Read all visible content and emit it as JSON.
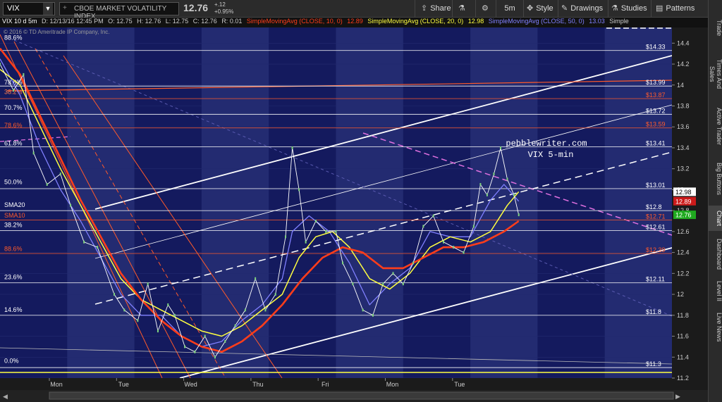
{
  "toolbar": {
    "symbol": "VIX",
    "name": "CBOE MARKET VOLATILITY INDEX",
    "last": "12.76",
    "change": "+.12",
    "change_pct": "+0.95%",
    "share": "Share",
    "timeframe": "5m",
    "style": "Style",
    "drawings": "Drawings",
    "studies": "Studies",
    "patterns": "Patterns"
  },
  "infobar": {
    "period": "VIX 10 d 5m",
    "date": "D: 12/13/16 12:45 PM",
    "open": "O: 12.75",
    "high": "H: 12.76",
    "low": "L: 12.75",
    "close": "C: 12.76",
    "range": "R: 0.01",
    "sma10_label": "SimpleMovingAvg (CLOSE, 10, 0)",
    "sma10_value": "12.89",
    "sma20_label": "SimpleMovingAvg (CLOSE, 20, 0)",
    "sma20_value": "12.98",
    "sma50_label": "SimpleMovingAvg (CLOSE, 50, 0)",
    "sma50_value": "13.03",
    "more": "Simple"
  },
  "sidebar": [
    "Trade",
    "Times And Sales",
    "Active Trader",
    "Big Buttons",
    "Chart",
    "Dashboard",
    "Level II",
    "Live News"
  ],
  "chart_data": {
    "type": "line",
    "title": "",
    "copyright": "© 2016 © TD Ameritrade IP Company, Inc.",
    "watermark": [
      "pebblewriter.com",
      "VIX 5-min"
    ],
    "x_ticks": [
      "Mon",
      "Tue",
      "Wed",
      "Thu",
      "Fri",
      "Mon",
      "Tue"
    ],
    "y_ticks": [
      11.2,
      11.4,
      11.6,
      11.8,
      12,
      12.2,
      12.4,
      12.6,
      12.8,
      13,
      13.2,
      13.4,
      13.6,
      13.8,
      14,
      14.2,
      14.4
    ],
    "ylim": [
      11.2,
      14.55
    ],
    "grid": true,
    "x_range": [
      0,
      10
    ],
    "close": [
      [
        0,
        14.2
      ],
      [
        0.2,
        13.95
      ],
      [
        0.35,
        14.1
      ],
      [
        0.5,
        13.35
      ],
      [
        0.7,
        13.05
      ],
      [
        0.9,
        13.15
      ],
      [
        1.05,
        12.85
      ],
      [
        1.25,
        12.5
      ],
      [
        1.45,
        12.45
      ],
      [
        1.7,
        12.0
      ],
      [
        1.85,
        11.85
      ],
      [
        2.05,
        11.75
      ],
      [
        2.2,
        12.1
      ],
      [
        2.35,
        11.65
      ],
      [
        2.5,
        11.9
      ],
      [
        2.6,
        11.8
      ],
      [
        2.75,
        11.5
      ],
      [
        2.9,
        11.45
      ],
      [
        3.05,
        11.6
      ],
      [
        3.2,
        11.4
      ],
      [
        3.35,
        11.55
      ],
      [
        3.5,
        11.7
      ],
      [
        3.65,
        11.85
      ],
      [
        3.8,
        12.15
      ],
      [
        3.95,
        11.85
      ],
      [
        4.1,
        12.0
      ],
      [
        4.25,
        12.55
      ],
      [
        4.35,
        13.4
      ],
      [
        4.45,
        13.0
      ],
      [
        4.55,
        12.5
      ],
      [
        4.7,
        12.7
      ],
      [
        4.85,
        12.6
      ],
      [
        5.0,
        12.6
      ],
      [
        5.1,
        12.3
      ],
      [
        5.25,
        12.1
      ],
      [
        5.4,
        11.85
      ],
      [
        5.55,
        11.8
      ],
      [
        5.7,
        12.1
      ],
      [
        5.85,
        12.2
      ],
      [
        6.0,
        12.1
      ],
      [
        6.15,
        12.3
      ],
      [
        6.3,
        12.65
      ],
      [
        6.45,
        12.75
      ],
      [
        6.6,
        12.5
      ],
      [
        6.75,
        12.45
      ],
      [
        6.9,
        12.4
      ],
      [
        7.05,
        12.65
      ],
      [
        7.15,
        13.05
      ],
      [
        7.25,
        12.95
      ],
      [
        7.35,
        13.15
      ],
      [
        7.45,
        13.4
      ],
      [
        7.55,
        13.1
      ],
      [
        7.65,
        12.95
      ],
      [
        7.72,
        12.76
      ]
    ],
    "series": [
      {
        "name": "SimpleMovingAvg (CLOSE, 10, 0)",
        "color": "#8080ff",
        "last": 12.89,
        "points": [
          [
            0,
            14.25
          ],
          [
            0.3,
            13.9
          ],
          [
            0.6,
            13.4
          ],
          [
            0.9,
            13.0
          ],
          [
            1.2,
            12.7
          ],
          [
            1.5,
            12.35
          ],
          [
            1.8,
            12.0
          ],
          [
            2.1,
            11.8
          ],
          [
            2.4,
            11.8
          ],
          [
            2.7,
            11.6
          ],
          [
            3.0,
            11.5
          ],
          [
            3.3,
            11.55
          ],
          [
            3.6,
            11.75
          ],
          [
            3.9,
            11.9
          ],
          [
            4.2,
            12.15
          ],
          [
            4.35,
            12.6
          ],
          [
            4.6,
            12.75
          ],
          [
            4.9,
            12.6
          ],
          [
            5.2,
            12.3
          ],
          [
            5.5,
            11.9
          ],
          [
            5.8,
            12.1
          ],
          [
            6.1,
            12.25
          ],
          [
            6.4,
            12.6
          ],
          [
            6.7,
            12.55
          ],
          [
            7.0,
            12.55
          ],
          [
            7.3,
            12.9
          ],
          [
            7.5,
            13.05
          ],
          [
            7.72,
            12.89
          ]
        ]
      },
      {
        "name": "SimpleMovingAvg (CLOSE, 20, 0)",
        "color": "#ffff40",
        "last": 12.98,
        "points": [
          [
            0,
            14.15
          ],
          [
            0.3,
            14.0
          ],
          [
            0.6,
            13.6
          ],
          [
            0.9,
            13.2
          ],
          [
            1.2,
            12.85
          ],
          [
            1.5,
            12.5
          ],
          [
            1.8,
            12.15
          ],
          [
            2.1,
            11.95
          ],
          [
            2.4,
            11.85
          ],
          [
            2.7,
            11.75
          ],
          [
            3.0,
            11.65
          ],
          [
            3.3,
            11.6
          ],
          [
            3.6,
            11.7
          ],
          [
            3.9,
            11.85
          ],
          [
            4.2,
            12.0
          ],
          [
            4.45,
            12.35
          ],
          [
            4.7,
            12.55
          ],
          [
            4.95,
            12.6
          ],
          [
            5.2,
            12.45
          ],
          [
            5.5,
            12.15
          ],
          [
            5.8,
            12.05
          ],
          [
            6.1,
            12.2
          ],
          [
            6.4,
            12.45
          ],
          [
            6.7,
            12.55
          ],
          [
            7.0,
            12.5
          ],
          [
            7.3,
            12.6
          ],
          [
            7.55,
            12.85
          ],
          [
            7.72,
            12.98
          ]
        ]
      },
      {
        "name": "SimpleMovingAvg (CLOSE, 50, 0)",
        "color": "#ff3d1a",
        "last": 13.03,
        "points": [
          [
            0,
            14.35
          ],
          [
            0.3,
            14.1
          ],
          [
            0.6,
            13.7
          ],
          [
            0.9,
            13.3
          ],
          [
            1.2,
            12.9
          ],
          [
            1.5,
            12.55
          ],
          [
            1.8,
            12.2
          ],
          [
            2.1,
            11.95
          ],
          [
            2.4,
            11.75
          ],
          [
            2.7,
            11.6
          ],
          [
            3.0,
            11.5
          ],
          [
            3.3,
            11.45
          ],
          [
            3.6,
            11.55
          ],
          [
            3.9,
            11.7
          ],
          [
            4.2,
            11.9
          ],
          [
            4.5,
            12.15
          ],
          [
            4.8,
            12.35
          ],
          [
            5.1,
            12.45
          ],
          [
            5.4,
            12.4
          ],
          [
            5.7,
            12.25
          ],
          [
            6.0,
            12.25
          ],
          [
            6.3,
            12.35
          ],
          [
            6.6,
            12.45
          ],
          [
            6.9,
            12.45
          ],
          [
            7.2,
            12.5
          ],
          [
            7.5,
            12.6
          ],
          [
            7.72,
            12.7
          ]
        ]
      }
    ],
    "horizontal_levels": [
      {
        "value": 14.33,
        "label": "$14.33",
        "color": "#ffffff"
      },
      {
        "value": 13.99,
        "label": "$13.99",
        "color": "#ffffff"
      },
      {
        "value": 13.87,
        "label": "$13.87",
        "color": "#ff5a2a"
      },
      {
        "value": 13.72,
        "label": "$13.72",
        "color": "#ffffff"
      },
      {
        "value": 13.59,
        "label": "$13.59",
        "color": "#ff5a2a"
      },
      {
        "value": 13.41,
        "label": "$13.41",
        "color": "#ffffff"
      },
      {
        "value": 13.01,
        "label": "$13.01",
        "color": "#ffffff"
      },
      {
        "value": 12.8,
        "label": "$12.8",
        "color": "#ffffff"
      },
      {
        "value": 12.71,
        "label": "$12.71",
        "color": "#ff5a2a"
      },
      {
        "value": 12.61,
        "label": "$12.61",
        "color": "#ffffff"
      },
      {
        "value": 12.39,
        "label": "$12.39",
        "color": "#ff5a2a"
      },
      {
        "value": 12.11,
        "label": "$12.11",
        "color": "#ffffff"
      },
      {
        "value": 11.8,
        "label": "$11.8",
        "color": "#ffffff"
      },
      {
        "value": 11.3,
        "label": "$11.3",
        "color": "#ffffff"
      }
    ],
    "fib_labels": [
      {
        "value": 14.42,
        "text": "88.6%",
        "color": "#ffffff"
      },
      {
        "value": 13.99,
        "text": "78.6%",
        "color": "#ffffff"
      },
      {
        "value": 13.9,
        "text": "38.2%",
        "color": "#ff7f50"
      },
      {
        "value": 13.75,
        "text": "70.7%",
        "color": "#ffffff"
      },
      {
        "value": 13.58,
        "text": "78.6%",
        "color": "#ff5a2a"
      },
      {
        "value": 13.41,
        "text": "61.8%",
        "color": "#ffffff"
      },
      {
        "value": 13.04,
        "text": "50.0%",
        "color": "#ffffff"
      },
      {
        "value": 12.82,
        "text": "SMA20",
        "color": "#ffffff"
      },
      {
        "value": 12.72,
        "text": "SMA10",
        "color": "#ff5a2a"
      },
      {
        "value": 12.63,
        "text": "38.2%",
        "color": "#ffffff"
      },
      {
        "value": 12.4,
        "text": "88.6%",
        "color": "#ff5a2a"
      },
      {
        "value": 12.13,
        "text": "23.6%",
        "color": "#ffffff"
      },
      {
        "value": 11.82,
        "text": "14.6%",
        "color": "#ffffff"
      },
      {
        "value": 11.33,
        "text": "0.0%",
        "color": "#ffffff"
      }
    ],
    "price_tags": [
      {
        "value": 12.98,
        "text": "12.98",
        "bg": "#ffffff",
        "fg": "#000000"
      },
      {
        "value": 12.89,
        "text": "12.89",
        "bg": "#cc1a1a",
        "fg": "#ffffff"
      },
      {
        "value": 12.76,
        "text": "12.76",
        "bg": "#1faa1f",
        "fg": "#ffffff"
      }
    ],
    "colors": {
      "background": "#141a5e",
      "band": "#303a82",
      "candle_line": "#ffffff",
      "axis_bg": "#1b1b1b"
    }
  }
}
